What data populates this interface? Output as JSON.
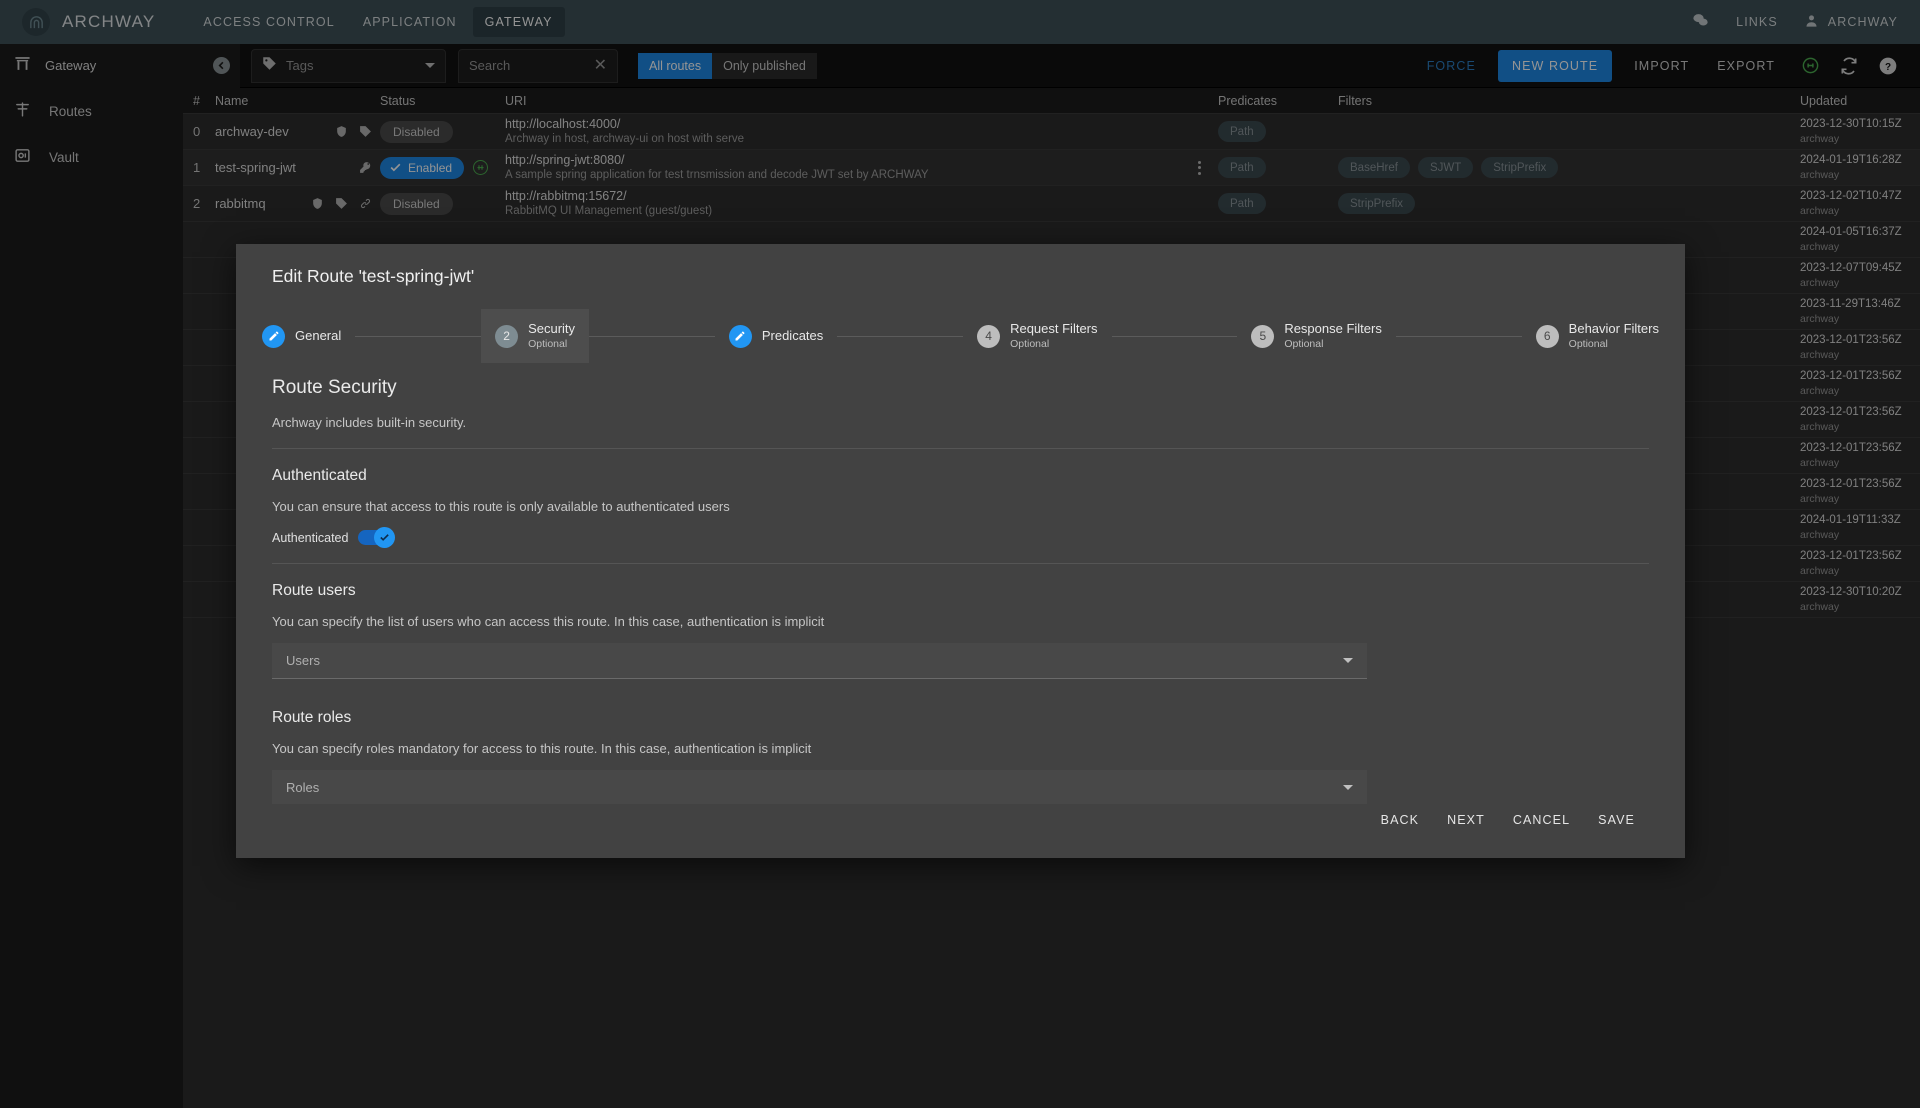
{
  "topnav": {
    "brand": "ARCHWAY",
    "logo_icon": "archway-logo-icon",
    "links": [
      {
        "label": "ACCESS CONTROL",
        "active": false
      },
      {
        "label": "APPLICATION",
        "active": false
      },
      {
        "label": "GATEWAY",
        "active": true
      }
    ],
    "right": {
      "chat_icon": "chat-bubbles-icon",
      "links_label": "LINKS",
      "user_icon": "person-icon",
      "user_label": "ARCHWAY"
    }
  },
  "toolbar": {
    "gateway_label": "Gateway",
    "gateway_icon": "gateway-torii-icon",
    "collapse_icon": "chevron-left-icon",
    "tags_placeholder": "Tags",
    "tags_icon": "tag-icon",
    "search_placeholder": "Search",
    "search_clear_icon": "close-icon",
    "segments": [
      {
        "label": "All routes",
        "active": true
      },
      {
        "label": "Only published",
        "active": false
      }
    ],
    "force_label": "FORCE",
    "new_route_label": "NEW ROUTE",
    "import_label": "IMPORT",
    "export_label": "EXPORT",
    "status_icon": "link-status-circle-icon",
    "refresh_icon": "refresh-icon",
    "help_icon": "help-circle-icon"
  },
  "sidebar": {
    "items": [
      {
        "label": "Routes",
        "icon": "routes-icon"
      },
      {
        "label": "Vault",
        "icon": "vault-icon"
      }
    ]
  },
  "table": {
    "columns": [
      "#",
      "Name",
      "Status",
      "URI",
      "Predicates",
      "Filters",
      "Updated"
    ],
    "rows": [
      {
        "num": "0",
        "name": "archway-dev",
        "name_icons": [
          "shield-icon",
          "tag-icon"
        ],
        "status": "Disabled",
        "enabled": false,
        "has_green_dot": false,
        "uri": "http://localhost:4000/",
        "uri_sub": "Archway in host, archway-ui on host with serve",
        "kebab": false,
        "predicates": [
          "Path"
        ],
        "filters": [],
        "updated": "2023-12-30T10:15Z",
        "updated_by": "archway"
      },
      {
        "num": "1",
        "name": "test-spring-jwt",
        "name_icons": [
          "key-icon"
        ],
        "status": "Enabled",
        "enabled": true,
        "has_green_dot": true,
        "uri": "http://spring-jwt:8080/",
        "uri_sub": "A sample spring application for test trnsmission and decode JWT set by ARCHWAY",
        "kebab": true,
        "predicates": [
          "Path"
        ],
        "filters": [
          "BaseHref",
          "SJWT",
          "StripPrefix"
        ],
        "updated": "2024-01-19T16:28Z",
        "updated_by": "archway"
      },
      {
        "num": "2",
        "name": "rabbitmq",
        "name_icons": [
          "shield-icon",
          "tag-icon",
          "link-icon"
        ],
        "status": "Disabled",
        "enabled": false,
        "has_green_dot": false,
        "uri": "http://rabbitmq:15672/",
        "uri_sub": "RabbitMQ UI Management (guest/guest)",
        "kebab": false,
        "predicates": [
          "Path"
        ],
        "filters": [
          "StripPrefix"
        ],
        "updated": "2023-12-02T10:47Z",
        "updated_by": "archway"
      },
      {
        "num": "",
        "name": "",
        "name_icons": [],
        "status": "",
        "enabled": false,
        "has_green_dot": false,
        "uri": "",
        "uri_sub": "",
        "kebab": false,
        "predicates": [],
        "filters": [],
        "updated": "2024-01-05T16:37Z",
        "updated_by": "archway"
      },
      {
        "num": "",
        "name": "",
        "name_icons": [],
        "status": "",
        "enabled": false,
        "has_green_dot": false,
        "uri": "",
        "uri_sub": "",
        "kebab": false,
        "predicates": [],
        "filters": [],
        "updated": "2023-12-07T09:45Z",
        "updated_by": "archway"
      },
      {
        "num": "",
        "name": "",
        "name_icons": [],
        "status": "",
        "enabled": false,
        "has_green_dot": false,
        "uri": "",
        "uri_sub": "",
        "kebab": false,
        "predicates": [],
        "filters": [],
        "updated": "2023-11-29T13:46Z",
        "updated_by": "archway"
      },
      {
        "num": "",
        "name": "",
        "name_icons": [],
        "status": "",
        "enabled": false,
        "has_green_dot": false,
        "uri": "",
        "uri_sub": "",
        "kebab": false,
        "predicates": [],
        "filters": [],
        "updated": "2023-12-01T23:56Z",
        "updated_by": "archway"
      },
      {
        "num": "",
        "name": "",
        "name_icons": [],
        "status": "",
        "enabled": false,
        "has_green_dot": false,
        "uri": "",
        "uri_sub": "",
        "kebab": false,
        "predicates": [],
        "filters": [],
        "updated": "2023-12-01T23:56Z",
        "updated_by": "archway"
      },
      {
        "num": "",
        "name": "",
        "name_icons": [],
        "status": "",
        "enabled": false,
        "has_green_dot": false,
        "uri": "",
        "uri_sub": "",
        "kebab": false,
        "predicates": [],
        "filters": [],
        "updated": "2023-12-01T23:56Z",
        "updated_by": "archway"
      },
      {
        "num": "",
        "name": "",
        "name_icons": [],
        "status": "",
        "enabled": false,
        "has_green_dot": false,
        "uri": "",
        "uri_sub": "",
        "kebab": false,
        "predicates": [],
        "filters": [],
        "updated": "2023-12-01T23:56Z",
        "updated_by": "archway"
      },
      {
        "num": "",
        "name": "",
        "name_icons": [],
        "status": "",
        "enabled": false,
        "has_green_dot": false,
        "uri": "",
        "uri_sub": "",
        "kebab": false,
        "predicates": [],
        "filters": [],
        "updated": "2023-12-01T23:56Z",
        "updated_by": "archway"
      },
      {
        "num": "",
        "name": "",
        "name_icons": [],
        "status": "",
        "enabled": false,
        "has_green_dot": false,
        "uri": "",
        "uri_sub": "",
        "kebab": false,
        "predicates": [],
        "filters": [],
        "updated": "2024-01-19T11:33Z",
        "updated_by": "archway"
      },
      {
        "num": "",
        "name": "",
        "name_icons": [],
        "status": "",
        "enabled": false,
        "has_green_dot": false,
        "uri": "",
        "uri_sub": "",
        "kebab": false,
        "predicates": [],
        "filters": [],
        "updated": "2023-12-01T23:56Z",
        "updated_by": "archway"
      },
      {
        "num": "",
        "name": "",
        "name_icons": [],
        "status": "",
        "enabled": false,
        "has_green_dot": false,
        "uri": "",
        "uri_sub": "",
        "kebab": false,
        "predicates": [],
        "filters": [],
        "updated": "2023-12-30T10:20Z",
        "updated_by": "archway"
      }
    ]
  },
  "modal": {
    "title": "Edit Route 'test-spring-jwt'",
    "steps": [
      {
        "label": "General",
        "optional": "",
        "state": "done",
        "num": "1"
      },
      {
        "label": "Security",
        "optional": "Optional",
        "state": "current",
        "num": "2"
      },
      {
        "label": "Predicates",
        "optional": "",
        "state": "done",
        "num": "3"
      },
      {
        "label": "Request Filters",
        "optional": "Optional",
        "state": "pending",
        "num": "4"
      },
      {
        "label": "Response Filters",
        "optional": "Optional",
        "state": "pending",
        "num": "5"
      },
      {
        "label": "Behavior Filters",
        "optional": "Optional",
        "state": "pending",
        "num": "6"
      }
    ],
    "section_title": "Route Security",
    "section_desc": "Archway includes built-in security.",
    "authenticated": {
      "heading": "Authenticated",
      "desc": "You can ensure that access to this route is only available to authenticated users",
      "toggle_label": "Authenticated",
      "toggle_on": true
    },
    "route_users": {
      "heading": "Route users",
      "desc": "You can specify the list of users who can access this route. In this case, authentication is implicit",
      "placeholder": "Users",
      "value": ""
    },
    "route_roles": {
      "heading": "Route roles",
      "desc": "You can specify roles mandatory for access to this route. In this case, authentication is implicit",
      "placeholder": "Roles",
      "value": ""
    },
    "buttons": [
      {
        "label": "BACK"
      },
      {
        "label": "NEXT"
      },
      {
        "label": "CANCEL"
      },
      {
        "label": "SAVE"
      }
    ]
  },
  "colors": {
    "accent_blue": "#1e88e5",
    "nav_bg": "#3f5259",
    "toolbar_bg": "#121212",
    "table_bg": "#2d2d2d",
    "modal_bg": "#424242",
    "status_green": "#4caf50"
  }
}
